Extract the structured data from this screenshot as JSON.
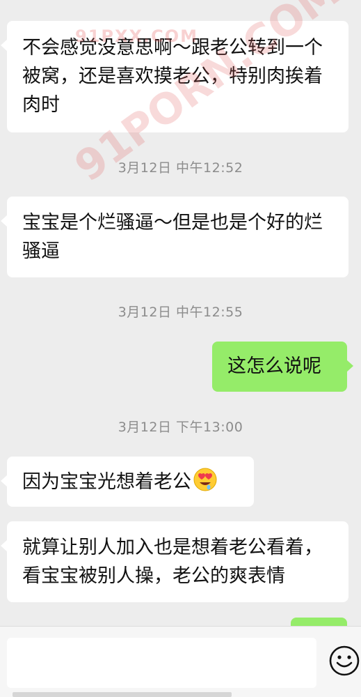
{
  "watermark": {
    "text_top": "91PXX.COM",
    "text_diag": "91PORN.COM"
  },
  "messages": [
    {
      "side": "left",
      "text": "不会感觉没意思啊～跟老公转到一个被窝，还是喜欢摸老公，特别肉挨着肉时"
    },
    {
      "type": "timestamp",
      "text": "3月12日 中午12:52"
    },
    {
      "side": "left",
      "text": "宝宝是个烂骚逼～但是也是个好的烂骚逼"
    },
    {
      "type": "timestamp",
      "text": "3月12日 中午12:55"
    },
    {
      "side": "right",
      "text": "这怎么说呢"
    },
    {
      "type": "timestamp",
      "text": "3月12日 下午13:00"
    },
    {
      "side": "left",
      "text": "因为宝宝光想着老公",
      "emoji": "heart-eyes-drool-emoji"
    },
    {
      "side": "left",
      "text": "就算让别人加入也是想着老公看着，看宝宝被别人操，老公的爽表情"
    },
    {
      "side": "right",
      "text": ""
    }
  ],
  "input": {
    "value": "",
    "emoji_button": "smile-icon"
  },
  "colors": {
    "background": "#ededed",
    "incoming_bubble": "#ffffff",
    "outgoing_bubble": "#95ec69",
    "timestamp": "#8c8c8c"
  }
}
